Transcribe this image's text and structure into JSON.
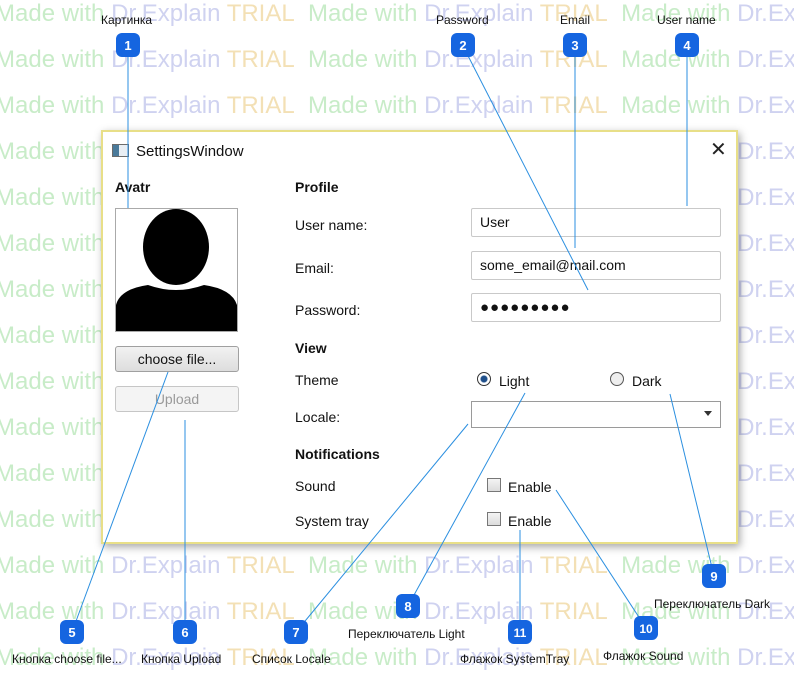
{
  "watermark": {
    "text_a": "Made with ",
    "text_b": "Dr.Explain",
    "text_c": " TRIAL"
  },
  "window": {
    "title": "SettingsWindow",
    "close_glyph": "✕"
  },
  "avatar_section": {
    "heading": "Avatr",
    "choose_button": "choose file...",
    "upload_button": "Upload"
  },
  "profile": {
    "heading": "Profile",
    "username_label": "User name:",
    "username_value": "User",
    "email_label": "Email:",
    "email_value": "some_email@mail.com",
    "password_label": "Password:",
    "password_value": "●●●●●●●●●"
  },
  "view": {
    "heading": "View",
    "theme_label": "Theme",
    "theme_light": "Light",
    "theme_dark": "Dark",
    "selected_theme": "Light",
    "locale_label": "Locale:",
    "locale_value": ""
  },
  "notifications": {
    "heading": "Notifications",
    "sound_label": "Sound",
    "sound_enable": "Enable",
    "tray_label": "System tray",
    "tray_enable": "Enable"
  },
  "callouts": {
    "c1": {
      "num": "1",
      "label": "Картинка"
    },
    "c2": {
      "num": "2",
      "label": "Password"
    },
    "c3": {
      "num": "3",
      "label": "Email"
    },
    "c4": {
      "num": "4",
      "label": "User name"
    },
    "c5": {
      "num": "5",
      "label": "Кнопка choose file..."
    },
    "c6": {
      "num": "6",
      "label": "Кнопка Upload"
    },
    "c7": {
      "num": "7",
      "label": "Список Locale"
    },
    "c8": {
      "num": "8",
      "label": "Переключатель Light"
    },
    "c9": {
      "num": "9",
      "label": "Переключатель Dark"
    },
    "c10": {
      "num": "10",
      "label": "Флажок Sound"
    },
    "c11": {
      "num": "11",
      "label": "Флажок SystemTray"
    }
  },
  "colors": {
    "callout_badge": "#1565e0",
    "callout_line": "#2b8fe0",
    "window_border": "#e8df88"
  }
}
